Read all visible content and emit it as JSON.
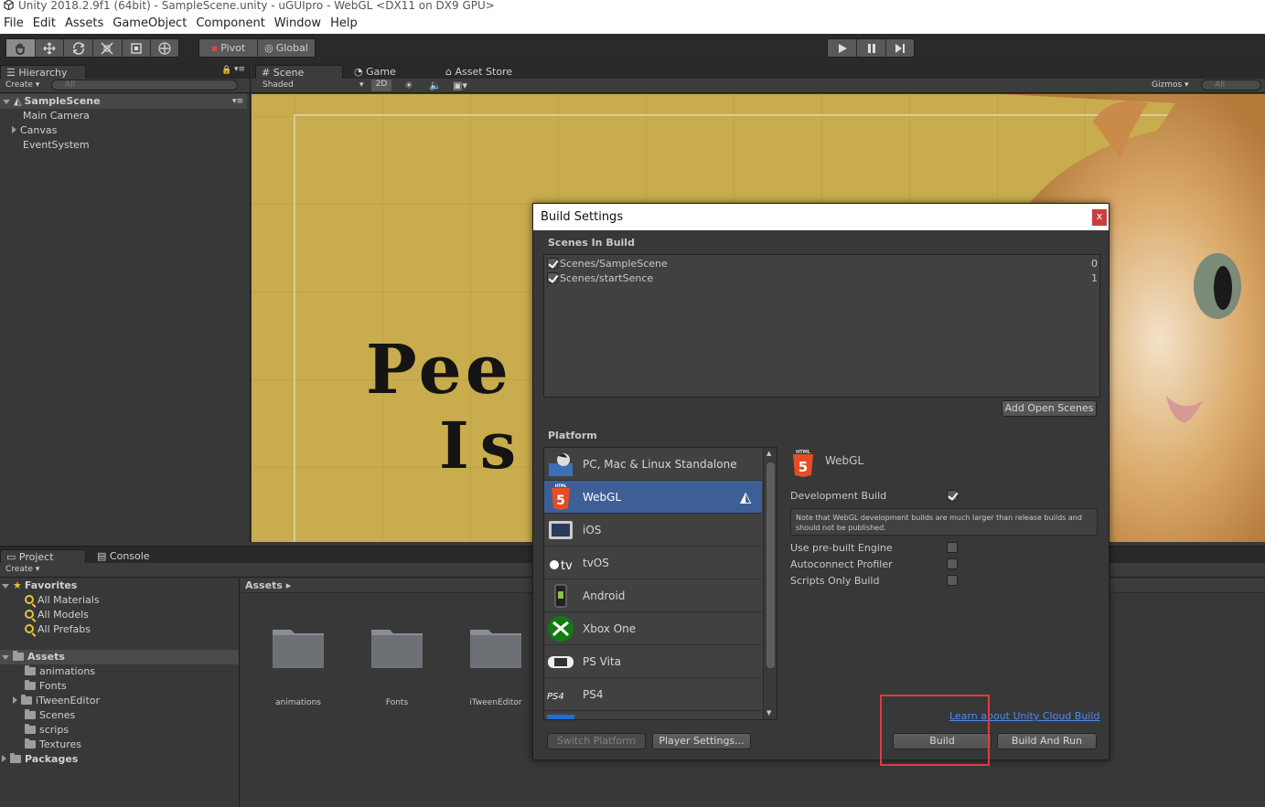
{
  "window_title": "Unity 2018.2.9f1 (64bit) - SampleScene.unity - uGUIpro - WebGL <DX11 on DX9 GPU>",
  "menu": [
    "File",
    "Edit",
    "Assets",
    "GameObject",
    "Component",
    "Window",
    "Help"
  ],
  "toolbar": {
    "pivot": "Pivot",
    "global": "Global"
  },
  "hierarchy": {
    "tab": "Hierarchy",
    "create": "Create",
    "search_placeholder": "All",
    "scene": "SampleScene",
    "items": [
      "Main Camera",
      "Canvas",
      "EventSystem"
    ]
  },
  "scene_view": {
    "tabs": [
      "Scene",
      "Game",
      "Asset Store"
    ],
    "shading": "Shaded",
    "mode_2d": "2D",
    "gizmos": "Gizmos",
    "search_placeholder": "All",
    "canvas_text_line1": "Pee",
    "canvas_text_line2": "Is"
  },
  "project": {
    "tabs": [
      "Project",
      "Console"
    ],
    "create": "Create",
    "favorites_label": "Favorites",
    "favorites": [
      "All Materials",
      "All Models",
      "All Prefabs"
    ],
    "assets_label": "Assets",
    "asset_folders": [
      "animations",
      "Fonts",
      "iTweenEditor",
      "Scenes",
      "scrips",
      "Textures"
    ],
    "packages_label": "Packages",
    "breadcrumb": "Assets",
    "grid_items": [
      "animations",
      "Fonts",
      "iTweenEditor"
    ]
  },
  "build_settings": {
    "title": "Build Settings",
    "close": "x",
    "scenes_header": "Scenes In Build",
    "scenes": [
      {
        "name": "Scenes/SampleScene",
        "index": "0",
        "checked": true
      },
      {
        "name": "Scenes/startSence",
        "index": "1",
        "checked": true
      }
    ],
    "add_open_scenes": "Add Open Scenes",
    "platform_header": "Platform",
    "platforms": [
      "PC, Mac & Linux Standalone",
      "WebGL",
      "iOS",
      "tvOS",
      "Android",
      "Xbox One",
      "PS Vita",
      "PS4"
    ],
    "selected_platform": "WebGL",
    "tvos_glyph": "tv",
    "ps4_glyph": "PS4",
    "html5_badge_top": "HTML",
    "html5_badge_num": "5",
    "right_title": "WebGL",
    "development_build": "Development Build",
    "development_build_checked": true,
    "note": "Note that WebGL development builds are much larger than release builds and should not be published.",
    "use_prebuilt": "Use pre-built Engine",
    "autoconnect": "Autoconnect Profiler",
    "scripts_only": "Scripts Only Build",
    "cloud_link": "Learn about Unity Cloud Build",
    "switch_platform": "Switch Platform",
    "player_settings": "Player Settings...",
    "build": "Build",
    "build_and_run": "Build And Run"
  },
  "colors": {
    "highlight_box": "#e03c3c",
    "selected_platform_bg": "#3e5f96",
    "link": "#4a8ef0"
  }
}
